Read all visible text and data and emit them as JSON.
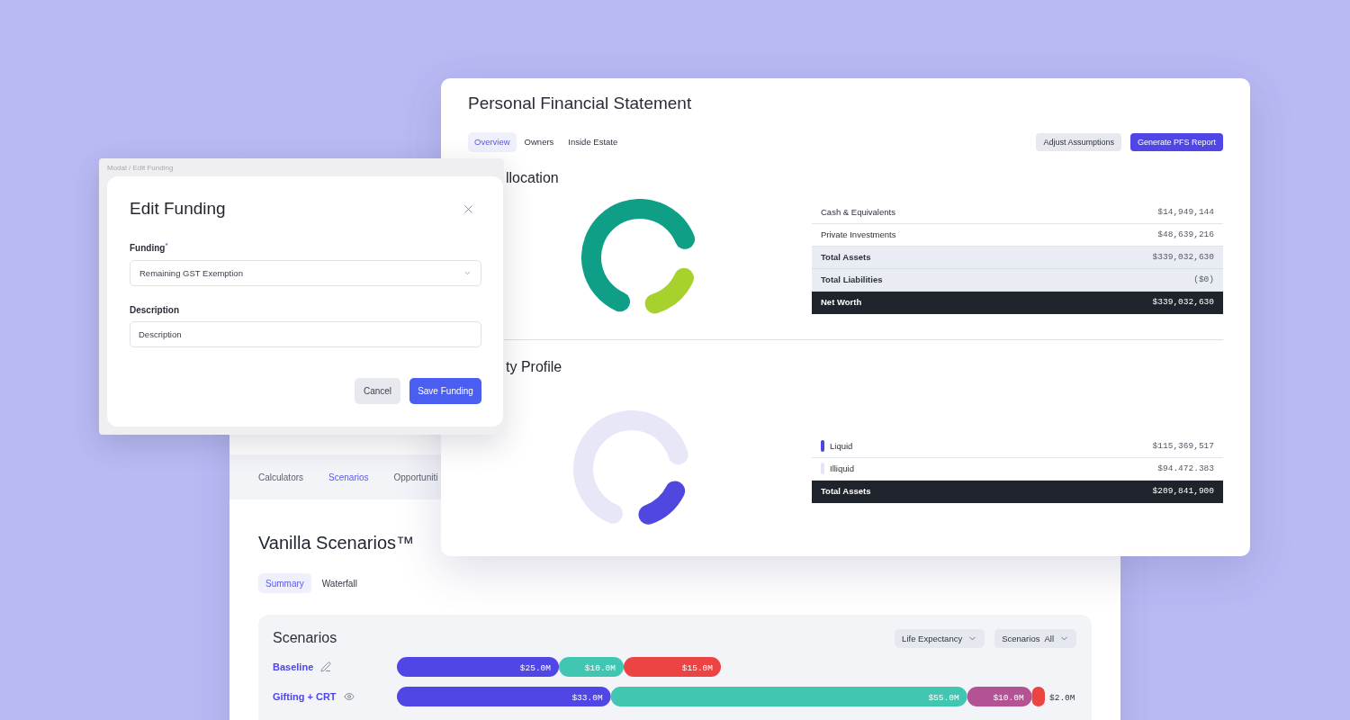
{
  "statement_window": {
    "title": "Personal Financial Statement",
    "tabs": [
      {
        "label": "Overview",
        "selected": true
      },
      {
        "label": "Owners",
        "selected": false
      },
      {
        "label": "Inside Estate",
        "selected": false
      }
    ],
    "buttons": [
      {
        "label": "Adjust Assumptions",
        "kind": "secondary"
      },
      {
        "label": "Generate PFS Report",
        "kind": "primary"
      }
    ],
    "sections": [
      {
        "heading": "llocation",
        "rows": [
          {
            "label": "Cash & Equivalents",
            "value": "$14,949,144",
            "kind": "item"
          },
          {
            "label": "Private Investments",
            "value": "$48,639,216",
            "kind": "item"
          },
          {
            "label": "Total Assets",
            "value": "$339,032,630",
            "kind": "subtotal"
          },
          {
            "label": "Total Liabilities",
            "value": "($0)",
            "kind": "subtotal"
          },
          {
            "label": "Net Worth",
            "value": "$339,032,630",
            "kind": "total"
          }
        ]
      },
      {
        "heading": "ty Profile",
        "rows": [
          {
            "label": "Liquid",
            "value": "$115,369,517",
            "kind": "item",
            "color": "#5046e0"
          },
          {
            "label": "Illiquid",
            "value": "$94.472.383",
            "kind": "item",
            "color": "#e4e4f7"
          },
          {
            "label": "Total Assets",
            "value": "$209,841,900",
            "kind": "total"
          }
        ]
      }
    ]
  },
  "modal": {
    "caption": "Modal / Edit Funding",
    "title": "Edit Funding",
    "fields": [
      {
        "kind": "select",
        "label": "Funding$^{*}$",
        "value": "Remaining GST Exemption"
      },
      {
        "kind": "text",
        "label": "Description",
        "placeholder": "Description"
      }
    ],
    "buttons": [
      {
        "label": "Cancel",
        "kind": "secondary"
      },
      {
        "label": "Save Funding",
        "kind": "primary"
      }
    ]
  },
  "background_window": {
    "nav_tabs": [
      {
        "label": "Calculators",
        "selected": false
      },
      {
        "label": "Scenarios",
        "selected": true
      },
      {
        "label": "Opportuniti",
        "selected": false
      }
    ],
    "title": "Vanilla Scenarios™",
    "view_tabs": [
      {
        "label": "Summary",
        "selected": true
      },
      {
        "label": "Waterfall",
        "selected": false
      }
    ],
    "scenarios_card": {
      "title": "Scenarios",
      "filters": [
        {
          "label": "Life Expectancy"
        },
        {
          "label": "Scenarios",
          "value": "All"
        }
      ],
      "row_actions": [
        {
          "kind": "edit"
        },
        {
          "kind": "view"
        }
      ],
      "chart_data": {
        "type": "bar",
        "orientation": "horizontal",
        "stacked": true,
        "categories": [
          "Baseline",
          "Gifting + CRT"
        ],
        "series": [
          {
            "color": "#4f46e5",
            "values": [
              25,
              33
            ],
            "value_labels": [
              "$25.0M",
              "$33.0M"
            ]
          },
          {
            "color": "#41c7b1",
            "values": [
              10,
              55
            ],
            "value_labels": [
              "$10.0M",
              "$55.0M"
            ]
          },
          {
            "color": "#b35394",
            "values": [
              null,
              10
            ],
            "value_labels": [
              null,
              "$10.0M"
            ]
          },
          {
            "color": "#ec4343",
            "values": [
              15,
              2
            ],
            "value_labels": [
              "$15.0M",
              "$2.0M"
            ]
          }
        ]
      }
    }
  }
}
